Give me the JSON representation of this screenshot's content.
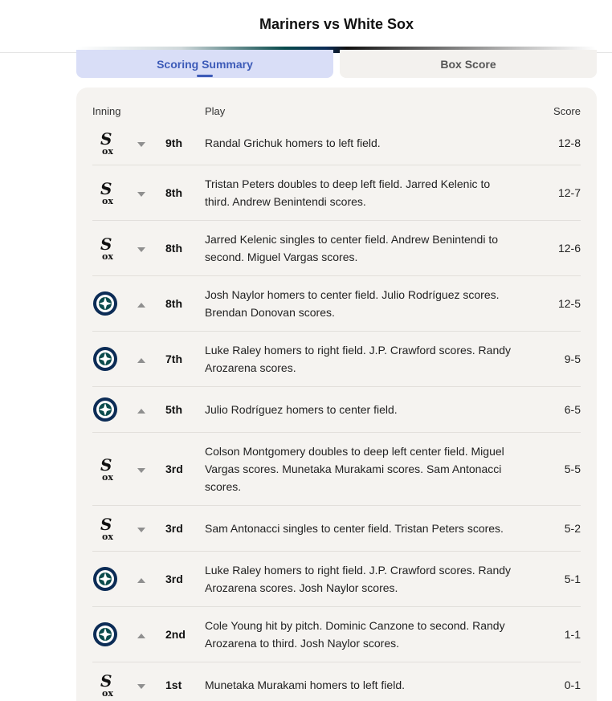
{
  "header": {
    "title": "Mariners vs White Sox"
  },
  "tabs": [
    {
      "label": "Scoring Summary",
      "active": true
    },
    {
      "label": "Box Score",
      "active": false
    }
  ],
  "columns": {
    "inning": "Inning",
    "play": "Play",
    "score": "Score"
  },
  "teams": {
    "sox": {
      "icon": "white-sox-logo",
      "color": "#111111"
    },
    "mariners": {
      "icon": "mariners-logo",
      "color": "#0c2c56",
      "accent": "#0a4b4c"
    }
  },
  "plays": [
    {
      "team": "sox",
      "half": "bottom",
      "inning": "9th",
      "text": "Randal Grichuk homers to left field.",
      "score": "12-8"
    },
    {
      "team": "sox",
      "half": "bottom",
      "inning": "8th",
      "text": "Tristan Peters doubles to deep left field. Jarred Kelenic to third. Andrew Benintendi scores.",
      "score": "12-7"
    },
    {
      "team": "sox",
      "half": "bottom",
      "inning": "8th",
      "text": "Jarred Kelenic singles to center field. Andrew Benintendi to second. Miguel Vargas scores.",
      "score": "12-6"
    },
    {
      "team": "mariners",
      "half": "top",
      "inning": "8th",
      "text": "Josh Naylor homers to center field. Julio Rodríguez scores. Brendan Donovan scores.",
      "score": "12-5"
    },
    {
      "team": "mariners",
      "half": "top",
      "inning": "7th",
      "text": "Luke Raley homers to right field. J.P. Crawford scores. Randy Arozarena scores.",
      "score": "9-5"
    },
    {
      "team": "mariners",
      "half": "top",
      "inning": "5th",
      "text": "Julio Rodríguez homers to center field.",
      "score": "6-5"
    },
    {
      "team": "sox",
      "half": "bottom",
      "inning": "3rd",
      "text": "Colson Montgomery doubles to deep left center field. Miguel Vargas scores. Munetaka Murakami scores. Sam Antonacci scores.",
      "score": "5-5"
    },
    {
      "team": "sox",
      "half": "bottom",
      "inning": "3rd",
      "text": "Sam Antonacci singles to center field. Tristan Peters scores.",
      "score": "5-2"
    },
    {
      "team": "mariners",
      "half": "top",
      "inning": "3rd",
      "text": "Luke Raley homers to right field. J.P. Crawford scores. Randy Arozarena scores. Josh Naylor scores.",
      "score": "5-1"
    },
    {
      "team": "mariners",
      "half": "top",
      "inning": "2nd",
      "text": "Cole Young hit by pitch. Dominic Canzone to second. Randy Arozarena to third. Josh Naylor scores.",
      "score": "1-1"
    },
    {
      "team": "sox",
      "half": "bottom",
      "inning": "1st",
      "text": "Munetaka Murakami homers to left field.",
      "score": "0-1"
    }
  ]
}
